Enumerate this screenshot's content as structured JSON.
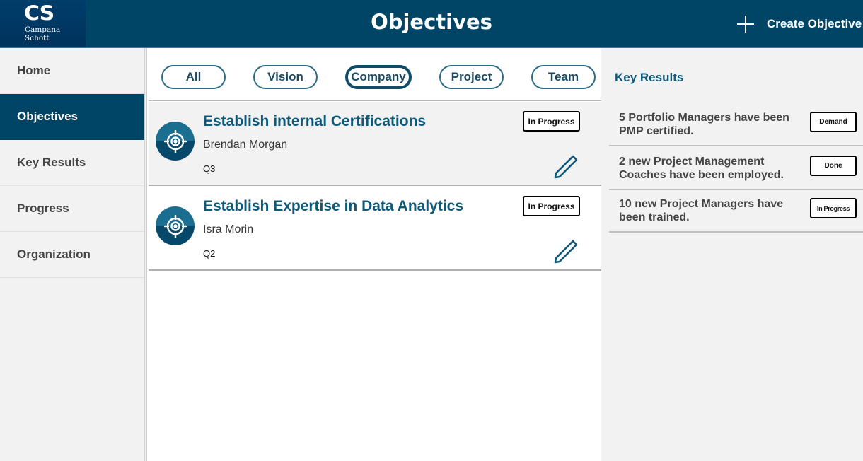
{
  "header": {
    "logo_mark": "CS",
    "logo_line1": "Campana",
    "logo_line2": "Schott",
    "title": "Objectives",
    "create_label": "Create Objective",
    "create_icon": "plus-icon"
  },
  "colors": {
    "primary": "#004466",
    "accent_text": "#0e5878",
    "chip_border": "#2b6b85"
  },
  "sidebar": {
    "items": [
      {
        "label": "Home",
        "active": false
      },
      {
        "label": "Objectives",
        "active": true
      },
      {
        "label": "Key Results",
        "active": false
      },
      {
        "label": "Progress",
        "active": false
      },
      {
        "label": "Organization",
        "active": false
      }
    ]
  },
  "filters": {
    "items": [
      {
        "label": "All",
        "active": false
      },
      {
        "label": "Vision",
        "active": false
      },
      {
        "label": "Company",
        "active": true
      },
      {
        "label": "Project",
        "active": false
      },
      {
        "label": "Team",
        "active": false
      }
    ]
  },
  "objectives": [
    {
      "title": "Establish internal Certifications",
      "owner": "Brendan Morgan",
      "quarter": "Q3",
      "status": "In Progress",
      "icon": "target-icon",
      "selected": true
    },
    {
      "title": "Establish Expertise in Data Analytics",
      "owner": "Isra Morin",
      "quarter": "Q2",
      "status": "In Progress",
      "icon": "target-icon",
      "selected": false
    }
  ],
  "key_results": {
    "heading": "Key Results",
    "items": [
      {
        "text": "5 Portfolio Managers have been PMP certified.",
        "status": "Demand"
      },
      {
        "text": "2 new Project Management Coaches have been employed.",
        "status": "Done"
      },
      {
        "text": "10 new Project Managers have been trained.",
        "status": "In Progress"
      }
    ]
  }
}
